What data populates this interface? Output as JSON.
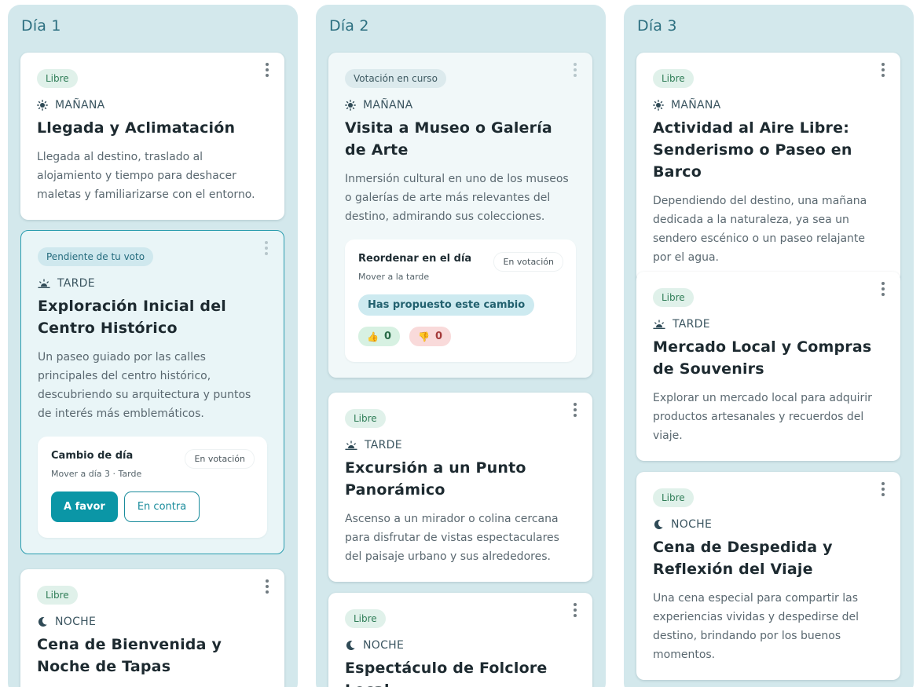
{
  "columns": [
    {
      "title": "Día 1",
      "cards": [
        {
          "badge": "Libre",
          "time": "MAÑANA",
          "time_icon": "sun-icon",
          "title": "Llegada y Aclimatación",
          "desc": "Llegada al destino, traslado al alojamiento y tiempo para deshacer maletas y familiarizarse con el entorno."
        },
        {
          "badge": "Pendiente de tu voto",
          "time": "TARDE",
          "time_icon": "sunset-icon",
          "title": "Exploración Inicial del Centro Histórico",
          "desc": "Un paseo guiado por las calles principales del centro histórico, descubriendo su arquitectura y puntos de interés más emblemáticos.",
          "proposal": {
            "title": "Cambio de día",
            "subtitle": "Mover a día 3 · Tarde",
            "status": "En votación",
            "favor_label": "A favor",
            "contra_label": "En contra"
          }
        },
        {
          "badge": "Libre",
          "time": "NOCHE",
          "time_icon": "moon-icon",
          "title": "Cena de Bienvenida y Noche de Tapas"
        }
      ]
    },
    {
      "title": "Día 2",
      "cards": [
        {
          "badge": "Votación en curso",
          "time": "MAÑANA",
          "time_icon": "sun-icon",
          "title": "Visita a Museo o Galería de Arte",
          "desc": "Inmersión cultural en uno de los museos o galerías de arte más relevantes del destino, admirando sus colecciones.",
          "proposal": {
            "title": "Reordenar en el día",
            "subtitle": "Mover a la tarde",
            "status": "En votación",
            "proposed_label": "Has propuesto este cambio",
            "up_emoji": "👍",
            "up_count": "0",
            "down_emoji": "👎",
            "down_count": "0"
          }
        },
        {
          "badge": "Libre",
          "time": "TARDE",
          "time_icon": "sunset-icon",
          "title": "Excursión a un Punto Panorámico",
          "desc": "Ascenso a un mirador o colina cercana para disfrutar de vistas espectaculares del paisaje urbano y sus alrededores."
        },
        {
          "badge": "Libre",
          "time": "NOCHE",
          "time_icon": "moon-icon",
          "title": "Espectáculo de Folclore Local"
        }
      ]
    },
    {
      "title": "Día 3",
      "cards": [
        {
          "badge": "Libre",
          "time": "MAÑANA",
          "time_icon": "sun-icon",
          "title": "Actividad al Aire Libre: Senderismo o Paseo en Barco",
          "desc": "Dependiendo del destino, una mañana dedicada a la naturaleza, ya sea un sendero escénico o un paseo relajante por el agua."
        },
        {
          "badge": "Libre",
          "time": "TARDE",
          "time_icon": "sunset-icon",
          "title": "Mercado Local y Compras de Souvenirs",
          "desc": "Explorar un mercado local para adquirir productos artesanales y recuerdos del viaje."
        },
        {
          "badge": "Libre",
          "time": "NOCHE",
          "time_icon": "moon-icon",
          "title": "Cena de Despedida y Reflexión del Viaje",
          "desc": "Una cena especial para compartir las experiencias vividas y despedirse del destino, brindando por los buenos momentos."
        }
      ]
    }
  ],
  "colors": {
    "column_bg": "#d3e8ec",
    "accent": "#0b96a6",
    "badge_free": "#e0f1ea",
    "badge_free_text": "#2f7d57"
  }
}
